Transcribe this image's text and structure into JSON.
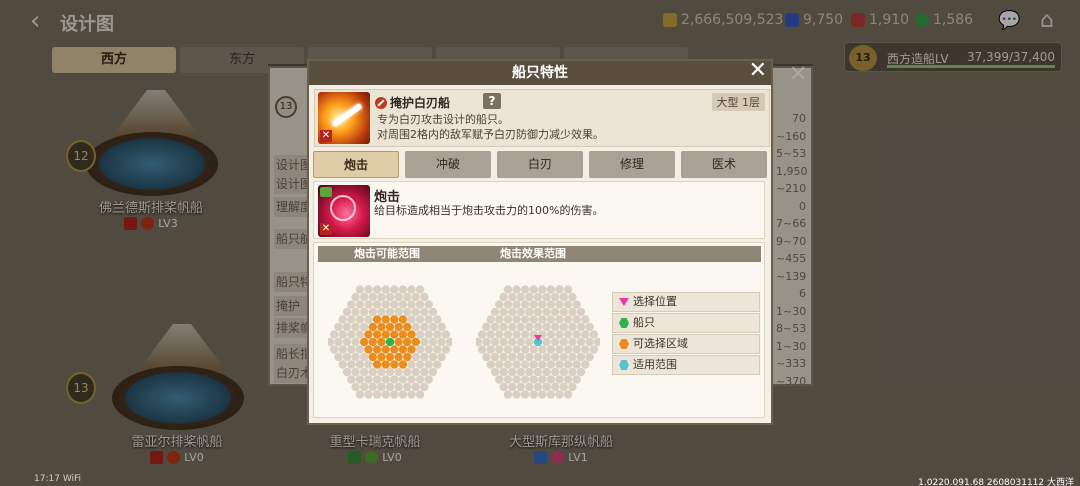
{
  "header": {
    "back_icon": "back-arrow-icon",
    "title": "设计图",
    "resources": [
      {
        "icon": "gold-icon",
        "value": "2,666,509,523",
        "color": "#c9a640"
      },
      {
        "icon": "blue-gem-icon",
        "value": "9,750",
        "color": "#3b59c9"
      },
      {
        "icon": "red-gem-icon",
        "value": "1,910",
        "color": "#c23b3b"
      },
      {
        "icon": "green-gem-icon",
        "value": "1,586",
        "color": "#3aa04a"
      }
    ],
    "chat_icon": "chat-icon",
    "home_icon": "home-icon"
  },
  "bg_tabs": [
    "西方",
    "东方",
    "",
    "",
    ""
  ],
  "shipbuild": {
    "level": "13",
    "label": "西方造船LV",
    "progress": "37,399/37,400"
  },
  "ships": [
    {
      "level": "12",
      "name": "佛兰德斯排桨帆船",
      "lv": "LV3"
    },
    {
      "level": "13",
      "name": "雷亚尔排桨帆船",
      "lv": "LV0"
    },
    {
      "level": "",
      "name": "重型卡瑞克帆船",
      "lv": "LV0"
    },
    {
      "level": "",
      "name": "大型斯库那纵帆船",
      "lv": "LV1"
    }
  ],
  "bg_panel": {
    "level": "13",
    "labels": [
      "设计图",
      "设计图",
      "理解度",
      "船只航",
      "船只特",
      "掩护",
      "排桨帆",
      "船长指",
      "白刃木"
    ],
    "values": [
      "70",
      "~160",
      "5~53",
      "1,950",
      "~210",
      "0",
      "7~66",
      "9~70",
      "~455",
      "~139",
      "6",
      "1~30",
      "8~53",
      "1~30",
      "~333",
      "~370",
      "~370"
    ]
  },
  "modal": {
    "title": "船只特性",
    "close_icon": "close-icon",
    "trait": {
      "name": "掩护白刃船",
      "desc1": "专为白刃攻击设计的船只。",
      "desc2": "对周围2格内的敌军赋予白刃防御力减少效果。",
      "size": "大型 1层"
    },
    "help": "?",
    "tabs": [
      "炮击",
      "冲破",
      "白刃",
      "修理",
      "医术"
    ],
    "skill": {
      "name": "炮击",
      "desc": "给目标造成相当于炮击攻击力的100%的伤害。"
    },
    "range_labels": {
      "possible": "炮击可能范围",
      "effect": "炮击效果范围"
    },
    "legend": [
      {
        "label": "选择位置",
        "color": "#e83aa5"
      },
      {
        "label": "船只",
        "color": "#2fb34a"
      },
      {
        "label": "可选择区域",
        "color": "#ea8d1e"
      },
      {
        "label": "适用范围",
        "color": "#56c2cf"
      }
    ]
  },
  "status": {
    "time": "17:17",
    "wifi": "WiFi",
    "version": "1.0220.091.68 2608031112 大西洋"
  }
}
